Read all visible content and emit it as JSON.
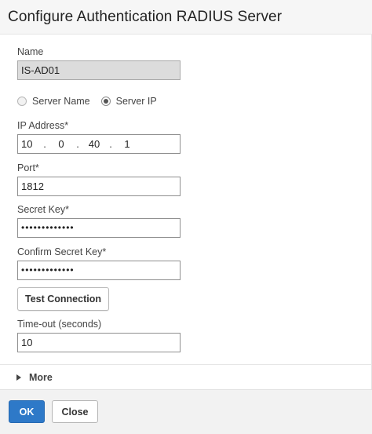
{
  "dialog": {
    "title": "Configure Authentication RADIUS Server"
  },
  "form": {
    "name_label": "Name",
    "name_value": "IS-AD01",
    "radio_server_name": "Server Name",
    "radio_server_ip": "Server IP",
    "selected_radio": "Server IP",
    "ip_label": "IP Address*",
    "ip_octets": [
      "10",
      "0",
      "40",
      "1"
    ],
    "port_label": "Port*",
    "port_value": "1812",
    "secret_label": "Secret Key*",
    "secret_value": "•••••••••••••",
    "confirm_label": "Confirm Secret Key*",
    "confirm_value": "•••••••••••••",
    "test_button": "Test Connection",
    "timeout_label": "Time-out (seconds)",
    "timeout_value": "10",
    "more_label": "More"
  },
  "footer": {
    "ok_label": "OK",
    "close_label": "Close"
  },
  "colors": {
    "primary_button": "#2e79c8",
    "header_bg": "#f6f6f6",
    "footer_bg": "#f2f2f2",
    "readonly_bg": "#dcdcdc"
  },
  "icons": {
    "more_toggle": "triangle-right-icon"
  }
}
